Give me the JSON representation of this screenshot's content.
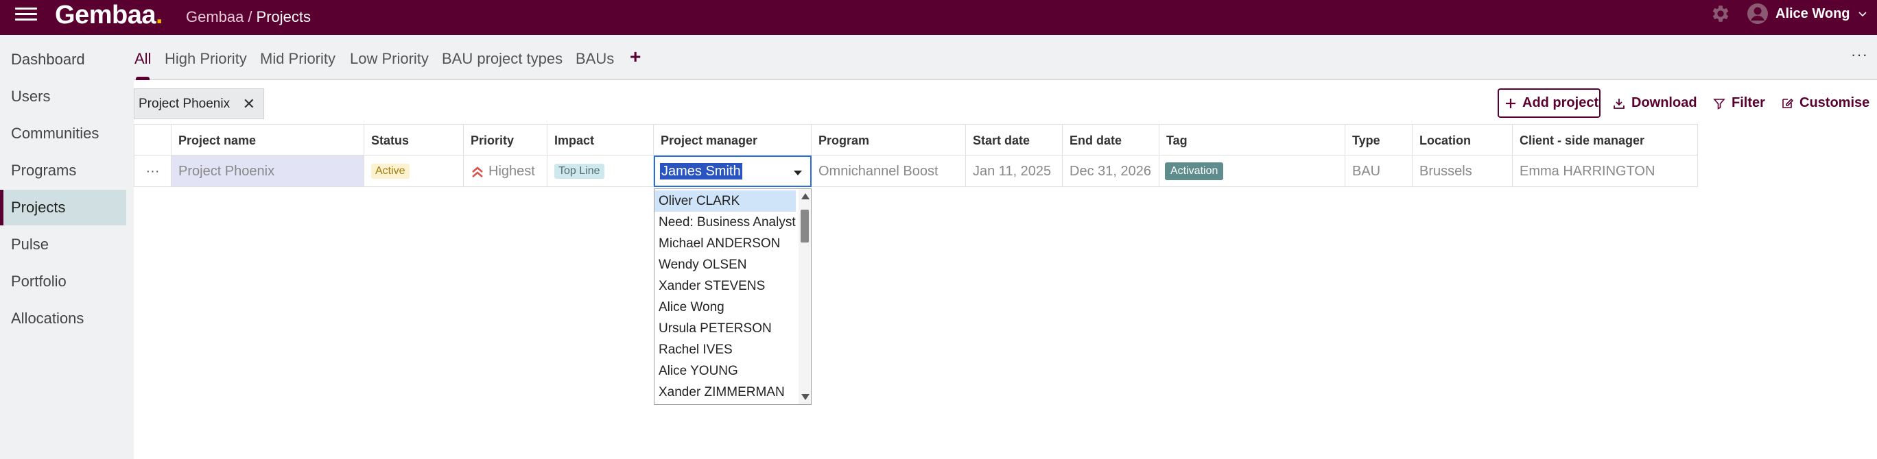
{
  "header": {
    "logo_text": "Gembaa",
    "logo_dot": ".",
    "breadcrumb": {
      "parent": "Gembaa",
      "separator": "/",
      "current": "Projects"
    },
    "user_name": "Alice Wong"
  },
  "sidebar": {
    "items": [
      {
        "label": "Dashboard"
      },
      {
        "label": "Users"
      },
      {
        "label": "Communities"
      },
      {
        "label": "Programs"
      },
      {
        "label": "Projects"
      },
      {
        "label": "Pulse"
      },
      {
        "label": "Portfolio"
      },
      {
        "label": "Allocations"
      }
    ],
    "active": "Projects"
  },
  "tabs": {
    "items": [
      {
        "label": "All"
      },
      {
        "label": "High Priority"
      },
      {
        "label": "Mid Priority"
      },
      {
        "label": "Low Priority"
      },
      {
        "label": "BAU project types"
      },
      {
        "label": "BAUs"
      }
    ],
    "add_label": "+",
    "more_label": "···",
    "active": "All"
  },
  "toolbar": {
    "filter_chip": "Project Phoenix",
    "chip_close": "✕",
    "add_project": "Add project",
    "download": "Download",
    "filter": "Filter",
    "customise": "Customise"
  },
  "table": {
    "columns": [
      "Project name",
      "Status",
      "Priority",
      "Impact",
      "Project manager",
      "Program",
      "Start date",
      "End date",
      "Tag",
      "Type",
      "Location",
      "Client - side manager"
    ],
    "row": {
      "menu": "···",
      "project_name": "Project Phoenix",
      "status": "Active",
      "priority": "Highest",
      "impact": "Top Line",
      "project_manager": "James Smith",
      "program": "Omnichannel Boost",
      "start_date": "Jan 11, 2025",
      "end_date": "Dec 31, 2026",
      "tag": "Activation",
      "type": "BAU",
      "location": "Brussels",
      "client_side_manager": "Emma HARRINGTON"
    }
  },
  "manager_dropdown": {
    "options": [
      "Oliver CLARK",
      "Need: Business Analyst",
      "Michael ANDERSON",
      "Wendy OLSEN",
      "Xander STEVENS",
      "Alice Wong",
      "Ursula PETERSON",
      "Rachel IVES",
      "Alice YOUNG",
      "Xander ZIMMERMAN"
    ],
    "highlighted": "Oliver CLARK"
  },
  "colors": {
    "brand": "#5a0030",
    "logo_dot": "#f3b500",
    "priority_highest": "#d9534f",
    "selection": "#2a55c0"
  }
}
